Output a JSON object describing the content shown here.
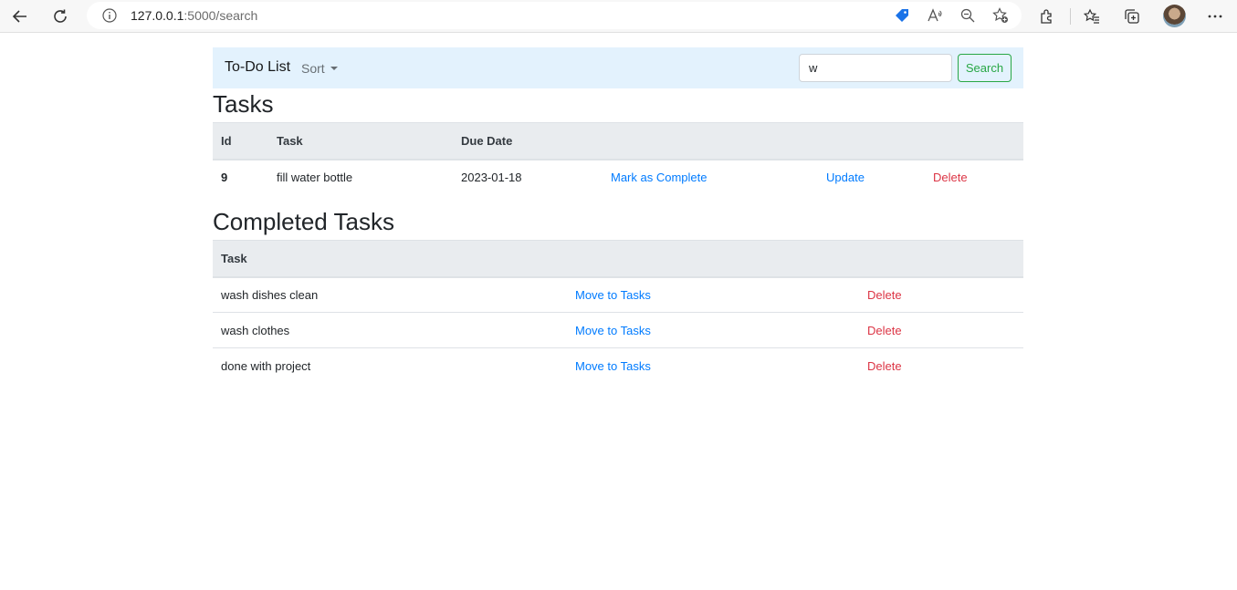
{
  "browser": {
    "url_host": "127.0.0.1",
    "url_path": ":5000/search"
  },
  "navbar": {
    "brand": "To-Do List",
    "sort_label": "Sort",
    "search_value": "w",
    "search_button": "Search"
  },
  "tasks": {
    "title": "Tasks",
    "columns": [
      "Id",
      "Task",
      "Due Date"
    ],
    "rows": [
      {
        "id": "9",
        "task": "fill water bottle",
        "due": "2023-01-18",
        "complete_label": "Mark as Complete",
        "update_label": "Update",
        "delete_label": "Delete"
      }
    ]
  },
  "completed": {
    "title": "Completed Tasks",
    "columns": [
      "Task"
    ],
    "rows": [
      {
        "task": "wash dishes clean",
        "move_label": "Move to Tasks",
        "delete_label": "Delete"
      },
      {
        "task": "wash clothes",
        "move_label": "Move to Tasks",
        "delete_label": "Delete"
      },
      {
        "task": "done with project",
        "move_label": "Move to Tasks",
        "delete_label": "Delete"
      }
    ]
  },
  "colors": {
    "navbar_bg": "#e3f2fd",
    "link": "#007bff",
    "danger": "#dc3545",
    "success": "#28a745",
    "table_head": "#e9ecef"
  }
}
